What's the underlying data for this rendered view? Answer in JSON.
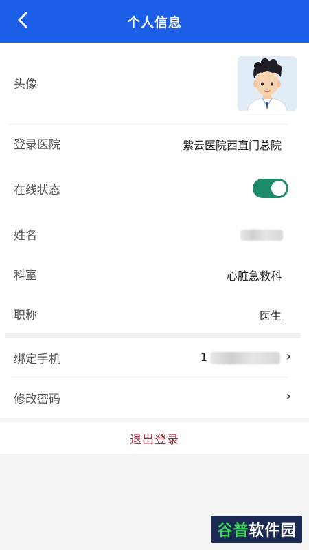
{
  "header": {
    "title": "个人信息",
    "back_icon": "chevron-left-icon"
  },
  "profile": {
    "avatar": {
      "label": "头像"
    },
    "hospital": {
      "label": "登录医院",
      "value": "紫云医院西直门总院"
    },
    "online_status": {
      "label": "在线状态",
      "enabled": true
    },
    "name": {
      "label": "姓名",
      "value": ""
    },
    "department": {
      "label": "科室",
      "value": "心脏急救科"
    },
    "title": {
      "label": "职称",
      "value": "医生"
    }
  },
  "account": {
    "phone": {
      "label": "绑定手机",
      "value_prefix": "1"
    },
    "password": {
      "label": "修改密码"
    }
  },
  "logout": {
    "label": "退出登录"
  },
  "watermark": {
    "part1": "谷普",
    "part2": "软件园"
  },
  "colors": {
    "header_bg": "#1d5ee8",
    "toggle_on": "#1c8a6b",
    "logout_text": "#9a2c3a"
  }
}
